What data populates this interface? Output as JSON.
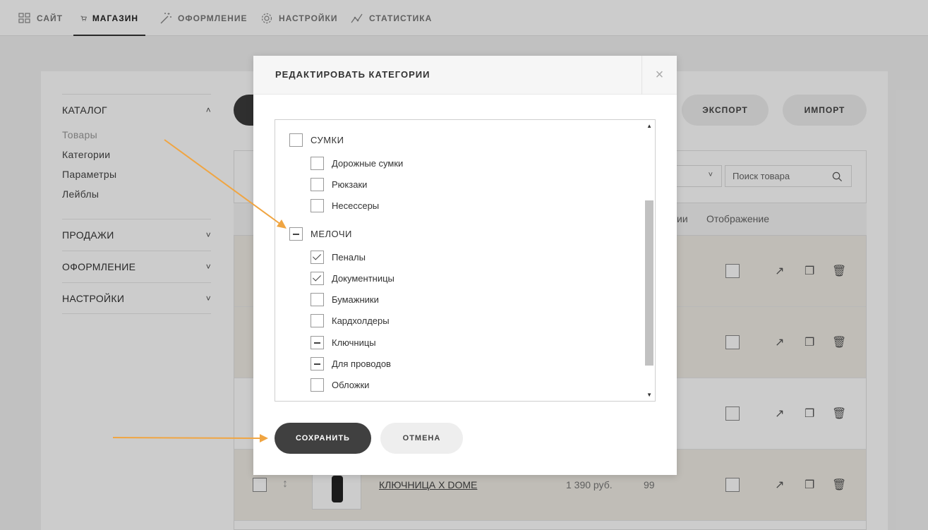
{
  "topnav": {
    "items": [
      {
        "label": "САЙТ",
        "icon": "grid-icon"
      },
      {
        "label": "МАГАЗИН",
        "icon": "cart-icon",
        "active": true
      },
      {
        "label": "ОФОРМЛЕНИЕ",
        "icon": "magic-wand-icon"
      },
      {
        "label": "НАСТРОЙКИ",
        "icon": "gear-icon"
      },
      {
        "label": "СТАТИСТИКА",
        "icon": "chart-line-icon"
      }
    ]
  },
  "sidebar": {
    "catalog": {
      "label": "КАТАЛОГ",
      "links": [
        "Товары",
        "Категории",
        "Параметры",
        "Лейблы"
      ]
    },
    "sales": {
      "label": "ПРОДАЖИ"
    },
    "design": {
      "label": "ОФОРМЛЕНИЕ"
    },
    "settings": {
      "label": "НАСТРОЙКИ"
    }
  },
  "toolbar": {
    "export_label": "ЭКСПОРТ",
    "import_label": "ИМПОРТ",
    "search_placeholder": "Поиск товара"
  },
  "table": {
    "header_partial": "ии",
    "header_display": "Отображение",
    "last_row": {
      "name": "КЛЮЧНИЦА X DOME",
      "price": "1 390 руб.",
      "qty": "99"
    }
  },
  "modal": {
    "title": "РЕДАКТИРОВАТЬ КАТЕГОРИИ",
    "close": "×",
    "categories": {
      "bags": {
        "label": "СУМКИ",
        "state": "unchecked",
        "children": [
          {
            "label": "Дорожные сумки",
            "state": "unchecked"
          },
          {
            "label": "Рюкзаки",
            "state": "unchecked"
          },
          {
            "label": "Несессеры",
            "state": "unchecked"
          }
        ]
      },
      "small": {
        "label": "МЕЛОЧИ",
        "state": "partial",
        "children": [
          {
            "label": "Пеналы",
            "state": "checked"
          },
          {
            "label": "Документницы",
            "state": "checked"
          },
          {
            "label": "Бумажники",
            "state": "unchecked"
          },
          {
            "label": "Кардхолдеры",
            "state": "unchecked"
          },
          {
            "label": "Ключницы",
            "state": "partial"
          },
          {
            "label": "Для проводов",
            "state": "partial"
          },
          {
            "label": "Обложки",
            "state": "unchecked"
          }
        ]
      }
    },
    "save_label": "СОХРАНИТЬ",
    "cancel_label": "ОТМЕНА"
  },
  "colors": {
    "accent_arrow": "#f0a542",
    "dark_button": "#404040"
  }
}
